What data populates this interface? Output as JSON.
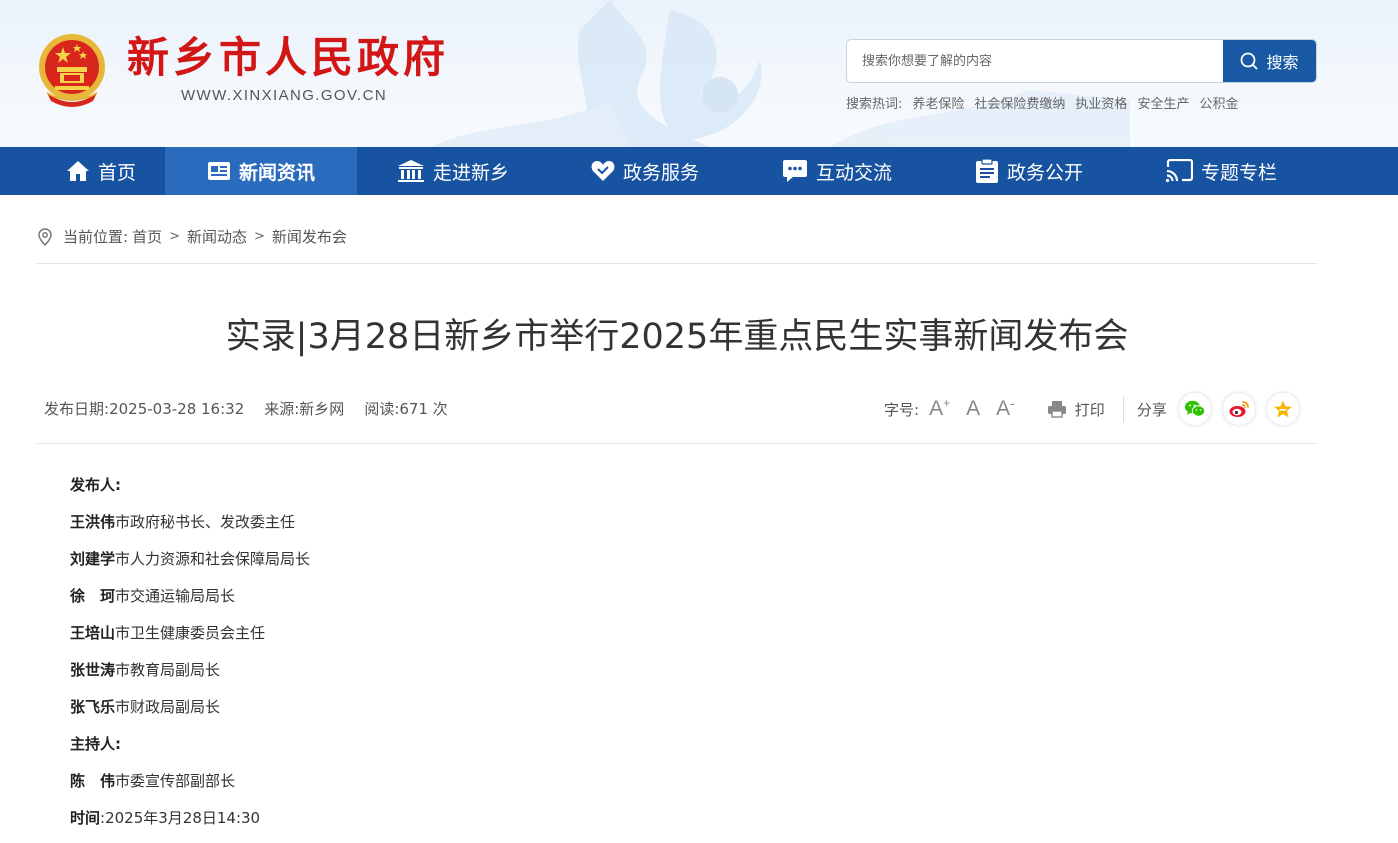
{
  "header": {
    "site_title": "新乡市人民政府",
    "site_url": "WWW.XINXIANG.GOV.CN",
    "search": {
      "placeholder": "搜索你想要了解的内容",
      "button_label": "搜索"
    },
    "hot_label": "搜索热词:",
    "hot_words": [
      "养老保险",
      "社会保险费缴纳",
      "执业资格",
      "安全生产",
      "公积金"
    ]
  },
  "nav": {
    "items": [
      {
        "label": "首页",
        "icon": "home-icon"
      },
      {
        "label": "新闻资讯",
        "icon": "news-icon",
        "active": true
      },
      {
        "label": "走进新乡",
        "icon": "building-icon"
      },
      {
        "label": "政务服务",
        "icon": "heart-icon"
      },
      {
        "label": "互动交流",
        "icon": "chat-icon"
      },
      {
        "label": "政务公开",
        "icon": "document-icon"
      },
      {
        "label": "专题专栏",
        "icon": "broadcast-icon"
      }
    ]
  },
  "breadcrumb": {
    "label": "当前位置:",
    "items": [
      "首页",
      "新闻动态",
      "新闻发布会"
    ],
    "separator": ">"
  },
  "article": {
    "title": "实录|3月28日新乡市举行2025年重点民生实事新闻发布会",
    "date_label": "发布日期:",
    "date": "2025-03-28 16:32",
    "source_label": "来源:",
    "source": "新乡网",
    "views_label": "阅读:",
    "views": "671 次",
    "font_size_label": "字号:",
    "font_larger": "A",
    "font_normal": "A",
    "font_smaller": "A",
    "font_larger_mark": "+",
    "font_smaller_mark": "-",
    "print_label": "打印",
    "share_label": "分享",
    "share_targets": [
      "wechat-icon",
      "weibo-icon",
      "favorite-icon"
    ],
    "colors": {
      "wechat": "#2dc100",
      "weibo": "#e6162d",
      "favorite": "#f7b500"
    },
    "body": [
      {
        "bold": "发布人:",
        "text": ""
      },
      {
        "bold": "王洪伟",
        "text": "市政府秘书长、发改委主任"
      },
      {
        "bold": "刘建学",
        "text": "市人力资源和社会保障局局长"
      },
      {
        "bold": "徐　珂",
        "text": "市交通运输局局长"
      },
      {
        "bold": "王培山",
        "text": "市卫生健康委员会主任"
      },
      {
        "bold": "张世涛",
        "text": "市教育局副局长"
      },
      {
        "bold": "张飞乐",
        "text": "市财政局副局长"
      },
      {
        "bold": "主持人:",
        "text": ""
      },
      {
        "bold": "陈　伟",
        "text": "市委宣传部副部长"
      },
      {
        "bold": "时间",
        "text": ":2025年3月28日14:30"
      }
    ]
  },
  "colors": {
    "brand_red": "#d21515",
    "nav_blue": "#1753a0",
    "nav_active": "#2a6bbd",
    "search_button": "#1a5aa5"
  }
}
